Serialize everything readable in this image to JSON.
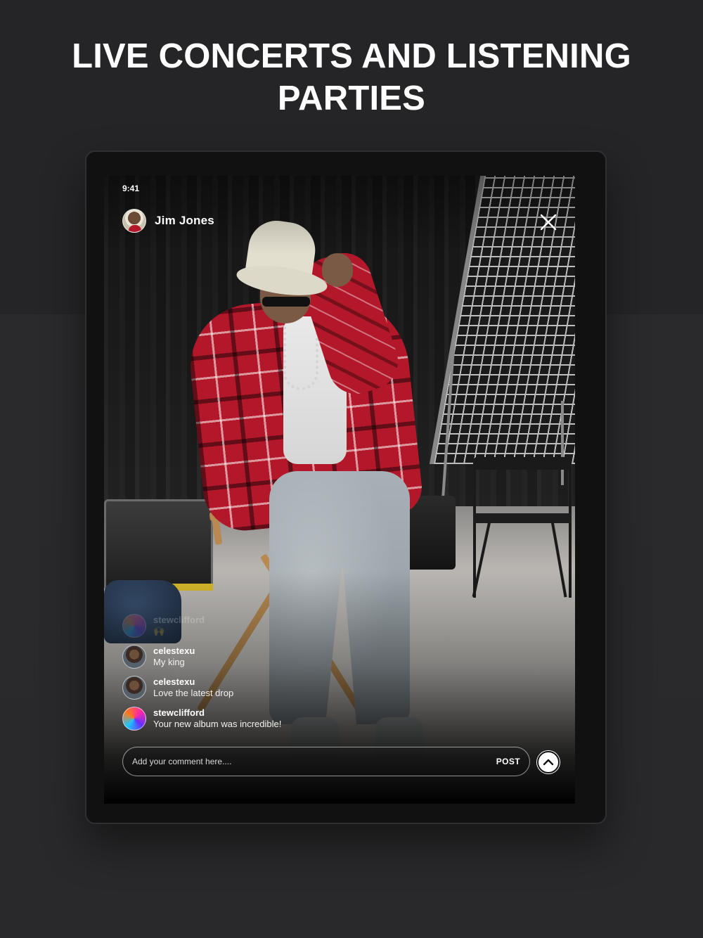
{
  "headline": {
    "line1": "LIVE CONCERTS AND LISTENING",
    "line2": "PARTIES"
  },
  "status_bar": {
    "time": "9:41"
  },
  "host": {
    "name": "Jim Jones",
    "avatar_icon": "host-avatar"
  },
  "close_icon": "close-icon",
  "comments": [
    {
      "user": "stewclifford",
      "message": "🙌",
      "faded": true
    },
    {
      "user": "celestexu",
      "message": "My king"
    },
    {
      "user": "celestexu",
      "message": "Love the latest drop"
    },
    {
      "user": "stewclifford",
      "message": "Your new album was incredible!"
    }
  ],
  "comment_bar": {
    "placeholder": "Add your comment here....",
    "post_label": "POST",
    "scroll_up_icon": "chevron-up-icon"
  },
  "colors": {
    "background": "#252527",
    "device": "#111112",
    "accent_jacket": "#b3182a"
  }
}
